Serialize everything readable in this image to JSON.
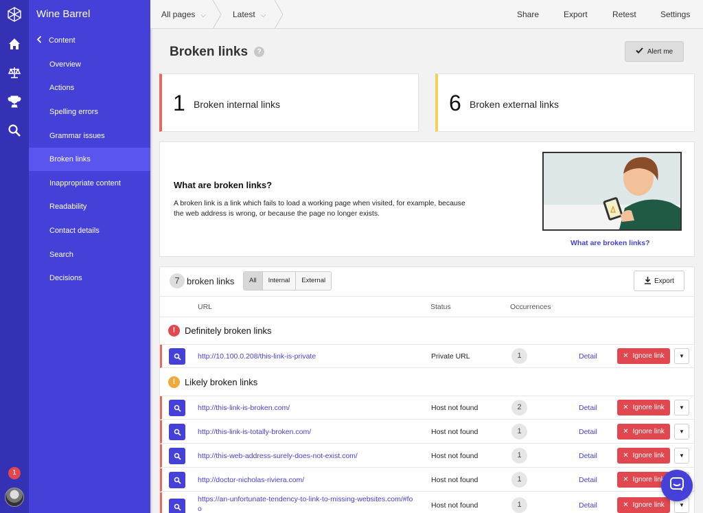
{
  "sidebar": {
    "org_name": "Wine Barrel",
    "back_label": "Content",
    "items": [
      {
        "label": "Overview"
      },
      {
        "label": "Actions"
      },
      {
        "label": "Spelling errors"
      },
      {
        "label": "Grammar issues"
      },
      {
        "label": "Broken links"
      },
      {
        "label": "Inappropriate content"
      },
      {
        "label": "Readability"
      },
      {
        "label": "Contact details"
      },
      {
        "label": "Search"
      },
      {
        "label": "Decisions"
      }
    ],
    "active_item": "Broken links",
    "notification_count": "1",
    "rail_icons": [
      "logo-icon",
      "home-icon",
      "scales-icon",
      "trophy-icon",
      "search-icon"
    ]
  },
  "topbar": {
    "pages_filter": "All pages",
    "version_filter": "Latest",
    "actions": [
      "Share",
      "Export",
      "Retest",
      "Settings"
    ]
  },
  "page": {
    "title": "Broken links",
    "help_glyph": "?",
    "alert_label": "Alert me"
  },
  "stats": {
    "internal": {
      "count": "1",
      "label": "Broken internal links"
    },
    "external": {
      "count": "6",
      "label": "Broken external links"
    }
  },
  "info": {
    "heading": "What are broken links?",
    "description": "A broken link is a link which fails to load a working page when visited, for example, because the web address is wrong, or because the page no longer exists.",
    "link_label": "What are broken links?"
  },
  "list": {
    "count": "7",
    "count_label": "broken links",
    "filters": [
      "All",
      "Internal",
      "External"
    ],
    "active_filter": "All",
    "export_label": "Export",
    "columns": {
      "url": "URL",
      "status": "Status",
      "occurrences": "Occurrences"
    },
    "detail_label": "Detail",
    "ignore_label": "Ignore link",
    "groups": [
      {
        "label": "Definitely broken links",
        "icon": "error-icon",
        "color": "#e0474f",
        "rows": [
          {
            "url": "http://10.100.0.208/this-link-is-private",
            "status": "Private URL",
            "occurrences": "1"
          }
        ]
      },
      {
        "label": "Likely broken links",
        "icon": "warning-icon",
        "color": "#f0a93a",
        "rows": [
          {
            "url": "http://this-link-is-broken.com/",
            "status": "Host not found",
            "occurrences": "2"
          },
          {
            "url": "http://this-link-is-totally-broken.com/",
            "status": "Host not found",
            "occurrences": "1"
          },
          {
            "url": "http://this-web-address-surely-does-not-exist.com/",
            "status": "Host not found",
            "occurrences": "1"
          },
          {
            "url": "http://doctor-nicholas-riviera.com/",
            "status": "Host not found",
            "occurrences": "1"
          },
          {
            "url": "https://an-unfortunate-tendency-to-link-to-missing-websites.com/#foo",
            "status": "Host not found",
            "occurrences": "1"
          }
        ]
      }
    ]
  },
  "colors": {
    "rail": "#3431b4",
    "nav": "#4540d8",
    "nav_active": "#5a55ef",
    "accent": "#4540d8",
    "danger": "#e0474f",
    "warning": "#f0d25a"
  }
}
